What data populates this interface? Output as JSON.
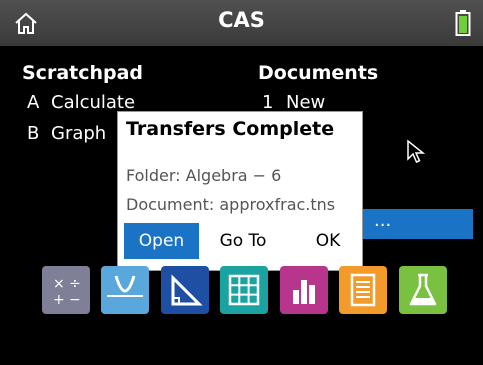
{
  "app": {
    "title": "CAS"
  },
  "left": {
    "title": "Scratchpad",
    "items": [
      {
        "key": "A",
        "label": "Calculate"
      },
      {
        "key": "B",
        "label": "Graph"
      }
    ]
  },
  "right": {
    "title": "Documents",
    "items": [
      {
        "key": "1",
        "label": "New"
      }
    ],
    "highlight_text": "..."
  },
  "dialog": {
    "title": "Transfers Complete",
    "folder": "Folder: Algebra − 6",
    "document": "Document: approxfrac.tns",
    "buttons": {
      "open": "Open",
      "goto": "Go To",
      "ok": "OK"
    }
  },
  "apps": [
    {
      "name": "calculator",
      "color": "#7f7f97"
    },
    {
      "name": "graphs",
      "color": "#5aa7dc"
    },
    {
      "name": "geometry",
      "color": "#1f4fa3"
    },
    {
      "name": "lists-spreadsheet",
      "color": "#1aa3a0"
    },
    {
      "name": "data-statistics",
      "color": "#b8358d"
    },
    {
      "name": "notes",
      "color": "#f39b2a"
    },
    {
      "name": "vernier-dataquest",
      "color": "#7ac142"
    }
  ],
  "colors": {
    "accent": "#1a73c4",
    "battery": "#6fcf3a"
  }
}
